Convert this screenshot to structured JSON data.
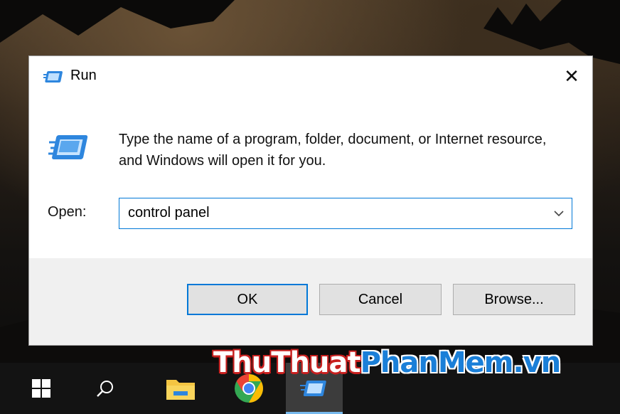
{
  "dialog": {
    "title": "Run",
    "close_glyph": "✕",
    "description": "Type the name of a program, folder, document, or Internet resource, and Windows will open it for you.",
    "open_label": "Open:",
    "open_value": "control panel",
    "ok_label": "OK",
    "cancel_label": "Cancel",
    "browse_label": "Browse..."
  },
  "taskbar": {
    "items": [
      "windows-start",
      "search",
      "file-explorer",
      "chrome",
      "run"
    ]
  },
  "watermark": {
    "part1": "ThuThuat",
    "part2": "PhanMem",
    "part3": ".vn"
  },
  "colors": {
    "accent": "#0078d7",
    "dialog_bg": "#ffffff",
    "footer_bg": "#f0f0f0",
    "taskbar_bg": "#131313"
  }
}
